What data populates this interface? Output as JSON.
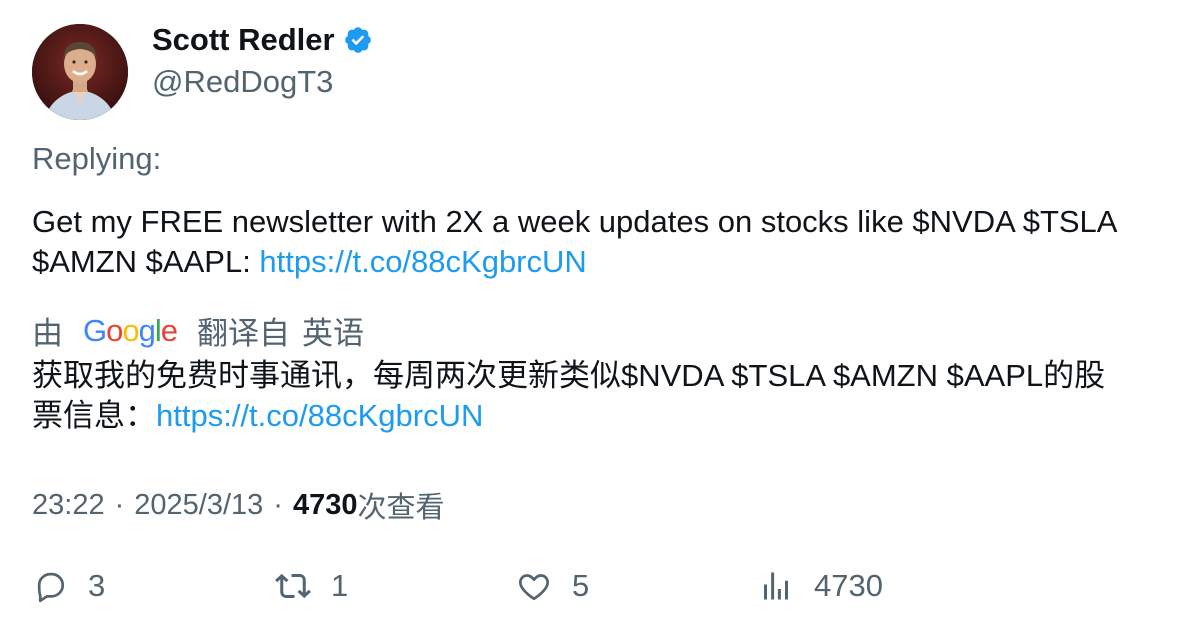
{
  "author": {
    "display_name": "Scott Redler",
    "handle": "@RedDogT3"
  },
  "reply": {
    "label": "Replying:"
  },
  "tweet": {
    "text_line1": "Get my FREE newsletter with 2X a week updates on stocks like $NVDA $TSLA",
    "text_line2_prefix": "$AMZN $AAPL: ",
    "link": "https://t.co/88cKgbrcUN"
  },
  "translation": {
    "by": "由",
    "provider": "Google",
    "translated_from": "翻译自",
    "language": "英语",
    "text_line1": "获取我的免费时事通讯，每周两次更新类似$NVDA $TSLA $AMZN $AAPL的股",
    "text_line2_prefix": "票信息：",
    "link": "https://t.co/88cKgbrcUN"
  },
  "meta": {
    "time": "23:22",
    "separator": "·",
    "date": "2025/3/13",
    "views_count": "4730",
    "views_label": "次查看"
  },
  "actions": {
    "replies": "3",
    "retweets": "1",
    "likes": "5",
    "views": "4730"
  },
  "colors": {
    "link": "#1d9bf0",
    "secondary_text": "#536471",
    "primary_text": "#0f1419",
    "verified_badge": "#1d9bf0"
  },
  "icons": {
    "reply": "reply-icon",
    "retweet": "retweet-icon",
    "like": "heart-icon",
    "views": "views-bar-chart-icon",
    "verified": "verified-badge-icon"
  }
}
